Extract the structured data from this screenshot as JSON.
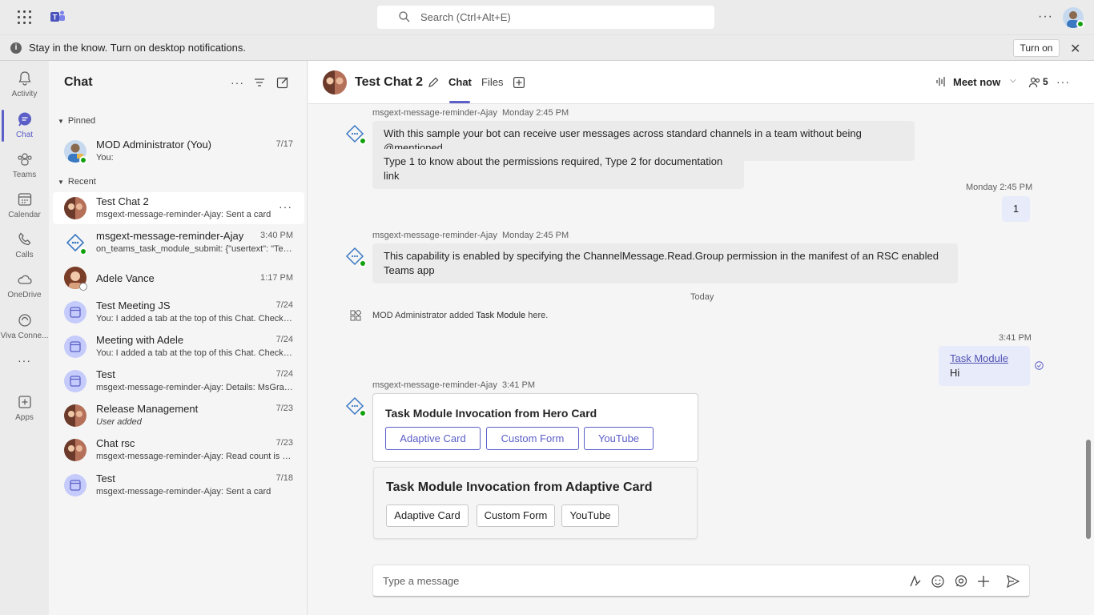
{
  "app": {
    "brand_color": "#5b5fc7"
  },
  "topbar": {
    "search_placeholder": "Search (Ctrl+Alt+E)"
  },
  "notification": {
    "message": "Stay in the know. Turn on desktop notifications.",
    "button": "Turn on"
  },
  "rail": [
    {
      "label": "Activity",
      "icon": "bell-icon"
    },
    {
      "label": "Chat",
      "icon": "chat-icon",
      "active": true
    },
    {
      "label": "Teams",
      "icon": "teams-icon"
    },
    {
      "label": "Calendar",
      "icon": "calendar-icon"
    },
    {
      "label": "Calls",
      "icon": "phone-icon"
    },
    {
      "label": "OneDrive",
      "icon": "cloud-icon"
    },
    {
      "label": "Viva Conne...",
      "icon": "viva-icon"
    },
    {
      "label": "Apps",
      "icon": "add-apps-icon"
    }
  ],
  "chatlist": {
    "title": "Chat",
    "pinned_label": "Pinned",
    "recent_label": "Recent",
    "pinned": [
      {
        "name": "MOD Administrator (You)",
        "preview": "You:",
        "time": "7/17"
      }
    ],
    "recent": [
      {
        "name": "Test Chat 2",
        "preview": "msgext-message-reminder-Ajay: Sent a card",
        "time": ""
      },
      {
        "name": "msgext-message-reminder-Ajay",
        "preview": "on_teams_task_module_submit: {\"usertext\": \"Testi...",
        "time": "3:40 PM"
      },
      {
        "name": "Adele Vance",
        "preview": "",
        "time": "1:17 PM"
      },
      {
        "name": "Test Meeting JS",
        "preview": "You: I added a tab at the top of this Chat. Check it...",
        "time": "7/24"
      },
      {
        "name": "Meeting with Adele",
        "preview": "You: I added a tab at the top of this Chat. Check it...",
        "time": "7/24"
      },
      {
        "name": "Test",
        "preview": "msgext-message-reminder-Ajay: Details:   MsGrap...",
        "time": "7/24"
      },
      {
        "name": "Release Management",
        "preview": "User added",
        "time": "7/23"
      },
      {
        "name": "Chat rsc",
        "preview": "msgext-message-reminder-Ajay: Read count is ze...",
        "time": "7/23"
      },
      {
        "name": "Test",
        "preview": "msgext-message-reminder-Ajay: Sent a card",
        "time": "7/18"
      }
    ]
  },
  "conversation": {
    "title": "Test Chat 2",
    "tabs": [
      "Chat",
      "Files"
    ],
    "meet_now": "Meet now",
    "participants": "5",
    "messages": {
      "m1_sender": "msgext-message-reminder-Ajay",
      "m1_time": "Monday 2:45 PM",
      "m1_text1": "With this sample your bot can receive user messages across standard channels in a team without being @mentioned",
      "m1_text2": "Type 1 to know about the permissions required, Type 2 for documentation link",
      "m2_time": "Monday 2:45 PM",
      "m2_text": "1",
      "m3_sender": "msgext-message-reminder-Ajay",
      "m3_time": "Monday 2:45 PM",
      "m3_text": "This capability is enabled by specifying the ChannelMessage.Read.Group permission in the manifest of an RSC enabled Teams app",
      "divider": "Today",
      "sys_actor": "MOD Administrator added ",
      "sys_app": "Task Module",
      "sys_tail": " here.",
      "m4_time": "3:41 PM",
      "m4_link": "Task Module",
      "m4_text": " Hi",
      "m5_sender": "msgext-message-reminder-Ajay",
      "m5_time": "3:41 PM"
    },
    "hero_card": {
      "title": "Task Module Invocation from Hero Card",
      "buttons": [
        "Adaptive Card",
        "Custom Form",
        "YouTube"
      ]
    },
    "adaptive_card": {
      "title": "Task Module Invocation from Adaptive Card",
      "buttons": [
        "Adaptive Card",
        "Custom Form",
        "YouTube"
      ]
    },
    "composer_placeholder": "Type a message"
  }
}
